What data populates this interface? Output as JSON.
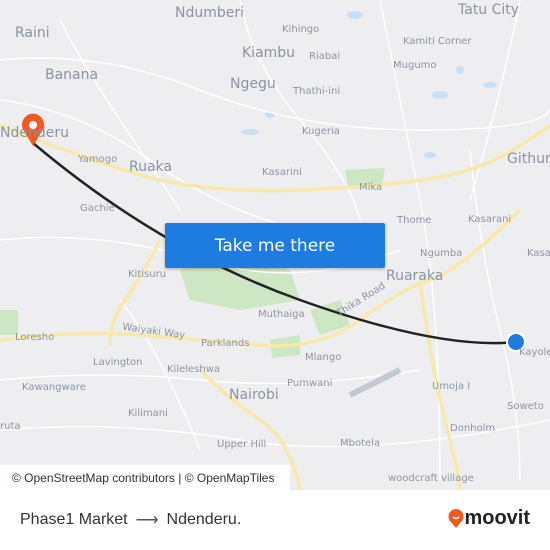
{
  "map": {
    "labels": {
      "ndumberi": "Ndumberi",
      "tatu_city": "Tatu City",
      "raini": "Raini",
      "kihingo": "Kihingo",
      "kiambu": "Kiambu",
      "riabai": "Riabai",
      "kamiti_corner": "Kamiti Corner",
      "banana": "Banana",
      "ngegu": "Ngegu",
      "mugumo": "Mugumo",
      "thathi_ini": "Thathi-ini",
      "ndenderu": "Ndenderu",
      "kugeria": "Kugeria",
      "githurai": "Githur",
      "yamogo": "Yamogo",
      "ruaka": "Ruaka",
      "kasarini": "Kasarini",
      "mika": "Mika",
      "gachie": "Gachie",
      "thome": "Thome",
      "kasarani": "Kasarani",
      "ngumba": "Ngumba",
      "kasa": "Kasa",
      "kitisuru": "Kitisuru",
      "ruaraka": "Ruaraka",
      "thika_road": "Thika Road",
      "loresho": "Loresho",
      "waiyaki_way": "Waiyaki Way",
      "muthaiga": "Muthaiga",
      "parklands": "Parklands",
      "kayole": "Kayole",
      "lavington": "Lavington",
      "mlango": "Mlango",
      "kileleshwa": "Kileleshwa",
      "pumwani": "Pumwani",
      "umoja": "Umoja I",
      "kawangware": "Kawangware",
      "nairobi": "Nairobi",
      "soweto": "Soweto",
      "kilimani": "Kilimani",
      "donholm": "Donholm",
      "ruta": "ruta",
      "mbotela": "Mbotela",
      "upper_hill": "Upper Hill",
      "woodcraft": "woodcraft village"
    },
    "origin_color": "#1e7be0",
    "destination_color": "#f05a22",
    "route_color": "#222222"
  },
  "cta": {
    "label": "Take me there"
  },
  "attribution": "© OpenStreetMap contributors | © OpenMapTiles",
  "footer": {
    "origin": "Phase1 Market",
    "arrow": "⟶",
    "destination": "Ndenderu."
  },
  "brand": {
    "name": "moovit",
    "color": "#f05a22"
  }
}
